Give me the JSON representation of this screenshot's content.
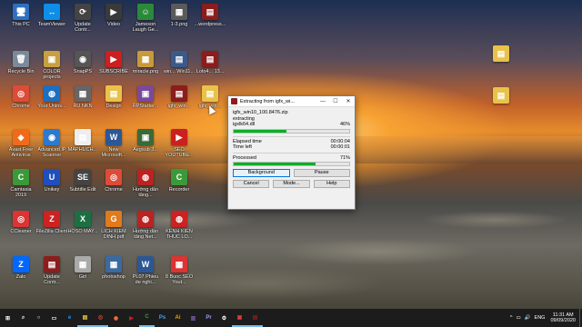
{
  "desktop_icons": [
    {
      "label": "This PC",
      "symbol": "🖥",
      "color": "#2f6fbf"
    },
    {
      "label": "TeamViewer",
      "symbol": "↔",
      "color": "#0e8ee9"
    },
    {
      "label": "Update Contr...",
      "symbol": "⟳",
      "color": "#444"
    },
    {
      "label": "Video",
      "symbol": "▶",
      "color": "#3a3a3a"
    },
    {
      "label": "Jameson Laugh Ge...",
      "symbol": "☺",
      "color": "#2a8a3a"
    },
    {
      "label": "1-3.png",
      "symbol": "▦",
      "color": "#5a5a5a"
    },
    {
      "label": "...wordpress...",
      "symbol": "▤",
      "color": "#8b1d1d"
    },
    {
      "label": "Recycle Bin",
      "symbol": "🗑",
      "color": "#7b8a9a"
    },
    {
      "label": "COLOR projects",
      "symbol": "▣",
      "color": "#c8a040"
    },
    {
      "label": "SnapPS",
      "symbol": "◉",
      "color": "#555"
    },
    {
      "label": "SUBSCRIBE",
      "symbol": "▶",
      "color": "#cc1f1f"
    },
    {
      "label": "miracle.png",
      "symbol": "▦",
      "color": "#c89a3a"
    },
    {
      "label": "win... Win11...",
      "symbol": "▤",
      "color": "#3a5a8a"
    },
    {
      "label": "Loto4... 13...",
      "symbol": "▤",
      "color": "#8b1d1d"
    },
    {
      "label": "Chrome",
      "symbol": "◎",
      "color": "#dd4b39"
    },
    {
      "label": "Your Unins...",
      "symbol": "◍",
      "color": "#1e6fbf"
    },
    {
      "label": "RU NKN",
      "symbol": "▦",
      "color": "#666"
    },
    {
      "label": "Design",
      "symbol": "▤",
      "color": "#e8c24a"
    },
    {
      "label": "RPStarter...",
      "symbol": "▣",
      "color": "#7a4a9a"
    },
    {
      "label": "igfx_win...",
      "symbol": "▤",
      "color": "#8b1d1d"
    },
    {
      "label": "igfx_win...",
      "symbol": "▤",
      "color": "#e8c24a"
    },
    {
      "label": "Avast Free Antivirus",
      "symbol": "◈",
      "color": "#f06a1a"
    },
    {
      "label": "Advanced IP Scanner",
      "symbol": "◉",
      "color": "#2a7ad0"
    },
    {
      "label": "MAPHUCH...",
      "symbol": "▤",
      "color": "#eee"
    },
    {
      "label": "New Microsoft...",
      "symbol": "W",
      "color": "#2b5797"
    },
    {
      "label": "Aegsub 3...",
      "symbol": "▣",
      "color": "#3a6a3a"
    },
    {
      "label": "SEO YOUTUBE...",
      "symbol": "▶",
      "color": "#cc1f1f"
    },
    {
      "label": "Camtasia 2019",
      "symbol": "C",
      "color": "#3a9a3a"
    },
    {
      "label": "Unikey",
      "symbol": "U",
      "color": "#1f4fbf"
    },
    {
      "label": "Subtitle Edit",
      "symbol": "SE",
      "color": "#444"
    },
    {
      "label": "Chrome",
      "symbol": "◎",
      "color": "#dd4b39"
    },
    {
      "label": "Hướng dẫn tăng...",
      "symbol": "◍",
      "color": "#b22"
    },
    {
      "label": "Recorder",
      "symbol": "C",
      "color": "#3a9a3a"
    },
    {
      "label": "CCleaner",
      "symbol": "◎",
      "color": "#d33"
    },
    {
      "label": "FileZilla Client",
      "symbol": "Z",
      "color": "#c22"
    },
    {
      "label": "HOSO MAY...",
      "symbol": "X",
      "color": "#1d6f42"
    },
    {
      "label": "LICH KIEM DINH.pdf",
      "symbol": "G",
      "color": "#e07a1a"
    },
    {
      "label": "Hướng dẫn tăng Net...",
      "symbol": "◍",
      "color": "#b22"
    },
    {
      "label": "KENH KIEN THUC LO...",
      "symbol": "◍",
      "color": "#c22"
    },
    {
      "label": "Zalo",
      "symbol": "Z",
      "color": "#0068ff"
    },
    {
      "label": "Update Contr...",
      "symbol": "▤",
      "color": "#8b1d1d"
    },
    {
      "label": "Girl",
      "symbol": "▦",
      "color": "#aaa"
    },
    {
      "label": "photoshop",
      "symbol": "▦",
      "color": "#3a6aa0"
    },
    {
      "label": "PL07 Phieu de nghi...",
      "symbol": "W",
      "color": "#2b5797"
    },
    {
      "label": "8 Buoc SEO Yout...",
      "symbol": "▦",
      "color": "#d33"
    },
    {
      "label": "",
      "symbol": "▤",
      "color": "#e8c24a"
    },
    {
      "label": "",
      "symbol": "▤",
      "color": "#e8c24a"
    }
  ],
  "dialog": {
    "title": "Extracting from igfx_wi...",
    "archive": "igfx_win10_100.8476.zip",
    "status": "extracting",
    "current_file": "igxlk64.dll",
    "file_progress_text": "46%",
    "file_progress": 0.46,
    "elapsed_label": "Elapsed time",
    "elapsed_value": "00:00:04",
    "left_label": "Time left",
    "left_value": "00:00:01",
    "processed_label": "Processed",
    "processed_text": "71%",
    "processed": 0.71,
    "btn_background": "Background",
    "btn_pause": "Pause",
    "btn_cancel": "Cancel",
    "btn_mode": "Mode...",
    "btn_help": "Help",
    "minimize": "—",
    "maximize": "☐",
    "close": "✕"
  },
  "taskbar": {
    "items": [
      {
        "symbol": "⊞",
        "color": "#ffffff"
      },
      {
        "symbol": "⌕",
        "color": "#ffffff"
      },
      {
        "symbol": "○",
        "color": "#ffffff"
      },
      {
        "symbol": "▭",
        "color": "#ffffff"
      },
      {
        "symbol": "e",
        "color": "#1e90ff"
      },
      {
        "symbol": "▤",
        "color": "#e8c24a"
      },
      {
        "symbol": "◎",
        "color": "#dd4b39"
      },
      {
        "symbol": "◉",
        "color": "#ff7139"
      },
      {
        "symbol": "▶",
        "color": "#cc1f1f"
      },
      {
        "symbol": "C",
        "color": "#3a9a3a"
      },
      {
        "symbol": "Ps",
        "color": "#31a8ff"
      },
      {
        "symbol": "Ai",
        "color": "#ff9a00"
      },
      {
        "symbol": "▥",
        "color": "#7a5aa0"
      },
      {
        "symbol": "Pr",
        "color": "#9999ff"
      },
      {
        "symbol": "⚙",
        "color": "#ffffff"
      },
      {
        "symbol": "▣",
        "color": "#e03a3a"
      },
      {
        "symbol": "▤",
        "color": "#8b1d1d"
      }
    ],
    "tray_symbols": [
      "^",
      "▭",
      "🔊"
    ],
    "lang": "ENG",
    "time": "11:31 AM",
    "date": "09/09/2020"
  }
}
